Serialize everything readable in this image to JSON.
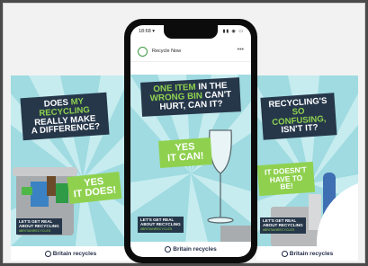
{
  "phone": {
    "time": "18:68 ▾",
    "signal_icons": "▮▮ ◉ ▭",
    "account_name": "Recycle Now",
    "more_icon": "•••"
  },
  "brand": "Britain recycles",
  "left_panel": {
    "question": [
      "DOES",
      "MY RECYCLING",
      "REALLY MAKE",
      "A DIFFERENCE?"
    ],
    "answer": [
      "YES",
      "IT DOES!"
    ],
    "tag": [
      "LET'S GET REAL",
      "ABOUT RECYCLING"
    ],
    "hashtag": "#BritainRecycles"
  },
  "center_panel": {
    "question": [
      "ONE ITEM",
      "IN THE",
      "WRONG BIN",
      "CAN'T",
      "HURT, CAN IT?"
    ],
    "answer": [
      "YES",
      "IT CAN!"
    ],
    "tag": [
      "LET'S GET REAL",
      "ABOUT RECYCLING"
    ],
    "hashtag": "#BritainRecycles"
  },
  "right_panel": {
    "question": [
      "RECYCLING'S",
      "SO CONFUSING,",
      "ISN'T IT?"
    ],
    "answer": [
      "IT DOESN'T",
      "HAVE TO BE!"
    ],
    "tag": [
      "LET'S GET REAL",
      "ABOUT RECYCLING"
    ],
    "hashtag": "#BritainRecycles"
  },
  "colors": {
    "navy": "#26374a",
    "green": "#8fd14f",
    "panel_bg": "#9fdbe1",
    "burst": "#c6ecef"
  },
  "icons": [
    "recycle-now-avatar-icon",
    "britain-recycles-logo-icon",
    "more-options-icon",
    "wine-glass-icon",
    "recycling-bin-icon"
  ]
}
